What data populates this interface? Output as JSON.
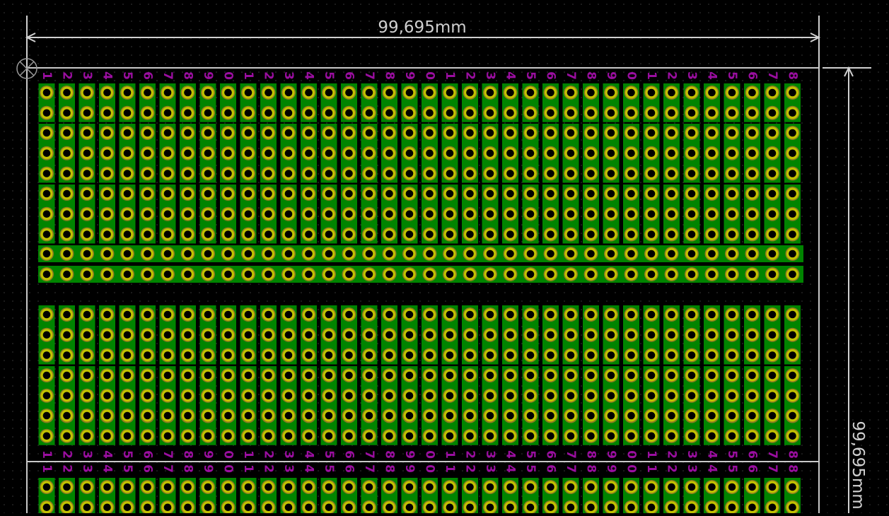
{
  "dimensions": {
    "width_label": "99,695mm",
    "height_label": "99,695mm"
  },
  "board": {
    "columns": 38,
    "column_labels": [
      "1",
      "2",
      "3",
      "4",
      "5",
      "6",
      "7",
      "8",
      "9",
      "0",
      "1",
      "2",
      "3",
      "4",
      "5",
      "6",
      "7",
      "8",
      "9",
      "0",
      "1",
      "2",
      "3",
      "4",
      "5",
      "6",
      "7",
      "8",
      "9",
      "0",
      "1",
      "2",
      "3",
      "4",
      "5",
      "6",
      "7",
      "8"
    ],
    "vertical_strip_groups": [
      {
        "rows": 2
      },
      {
        "rows": 3
      },
      {
        "rows": 3
      },
      {
        "rows": 3
      },
      {
        "rows": 3
      },
      {
        "rows": 2
      }
    ],
    "horizontal_rails": 2,
    "lower_board_visible_rows": 2
  },
  "colors": {
    "background": "#000000",
    "grid_dot": "#3a3a3a",
    "copper": "#008400",
    "pad": "#c2c200",
    "pad_ring": "#8a7a20",
    "drill": "#000000",
    "silkscreen_label": "#9a0ea0",
    "outline": "#c8c8c8",
    "dimension": "#d0d0d0",
    "origin_marker": "#9a9a9a"
  },
  "icons": {
    "origin": "origin-crosshair-icon"
  }
}
